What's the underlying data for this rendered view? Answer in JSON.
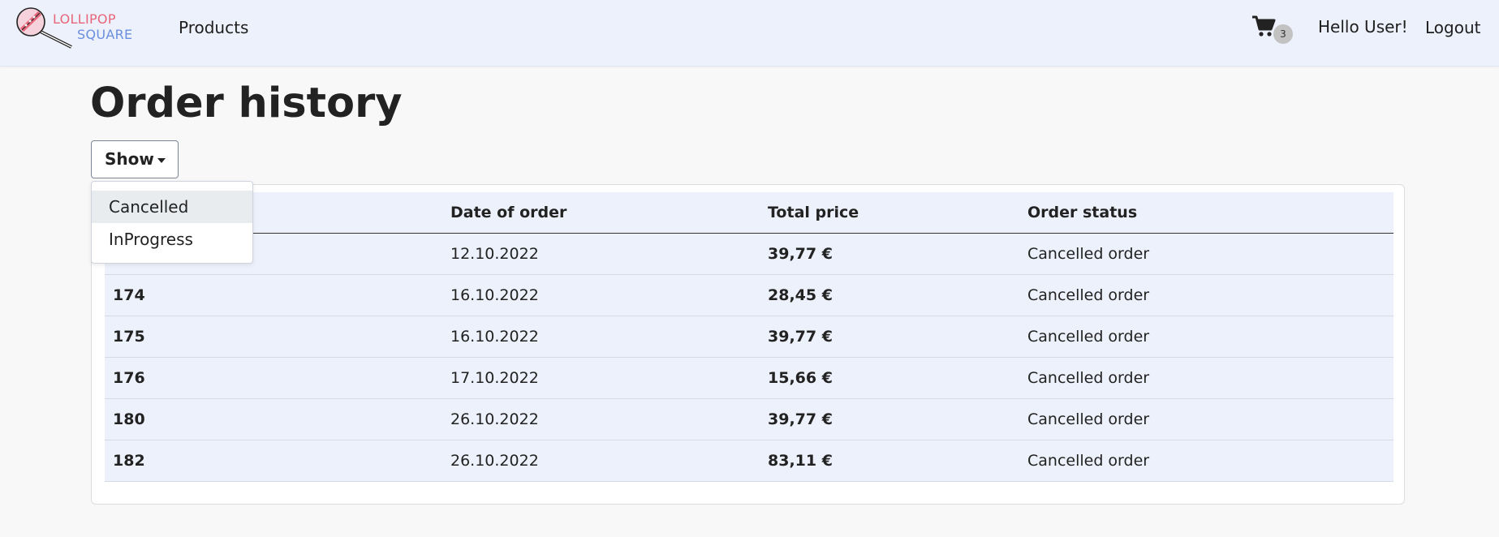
{
  "navbar": {
    "logo_line1": "LOLLIPOP",
    "logo_line2": "SQUARE",
    "products_label": "Products",
    "cart_count": "3",
    "greeting": "Hello User!",
    "logout_label": "Logout"
  },
  "page": {
    "title": "Order history"
  },
  "filter": {
    "button_label": "Show",
    "options": [
      "Cancelled",
      "InProgress"
    ],
    "highlighted": "Cancelled"
  },
  "table": {
    "headers": [
      "",
      "Date of order",
      "Total price",
      "Order status"
    ],
    "rows": [
      {
        "id": "",
        "date": "12.10.2022",
        "price": "39,77 €",
        "status": "Cancelled order"
      },
      {
        "id": "174",
        "date": "16.10.2022",
        "price": "28,45 €",
        "status": "Cancelled order"
      },
      {
        "id": "175",
        "date": "16.10.2022",
        "price": "39,77 €",
        "status": "Cancelled order"
      },
      {
        "id": "176",
        "date": "17.10.2022",
        "price": "15,66 €",
        "status": "Cancelled order"
      },
      {
        "id": "180",
        "date": "26.10.2022",
        "price": "39,77 €",
        "status": "Cancelled order"
      },
      {
        "id": "182",
        "date": "26.10.2022",
        "price": "83,11 €",
        "status": "Cancelled order"
      }
    ]
  },
  "colors": {
    "navbar_bg": "#edf1fb",
    "logo_pink": "#e8667a",
    "logo_blue": "#6a8ee0",
    "row_bg": "#edf1fb"
  },
  "icons": {
    "logo": "lollipop-icon",
    "cart": "shopping-cart-icon",
    "caret": "caret-down-icon"
  }
}
